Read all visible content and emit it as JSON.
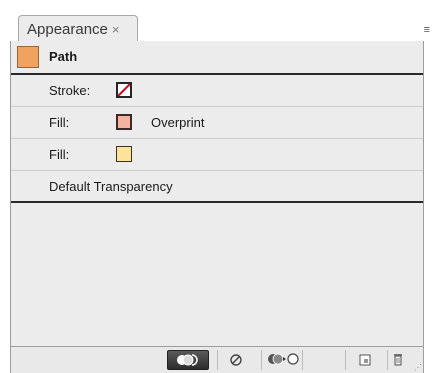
{
  "panel": {
    "tab_label": "Appearance",
    "tab_close": "×",
    "menu_icon": "≡"
  },
  "object": {
    "label": "Path",
    "swatch_color": "#f0a35e"
  },
  "attributes": [
    {
      "label": "Stroke:",
      "swatch": "none",
      "extra": ""
    },
    {
      "label": "Fill:",
      "swatch_color": "#f3b3a0",
      "extra": "Overprint"
    },
    {
      "label": "Fill:",
      "swatch_color": "#fde39a",
      "extra": ""
    }
  ],
  "transparency": {
    "label": "Default Transparency"
  },
  "toolbar_icons": [
    "new-art-basic-appearance-icon",
    "clear-appearance-icon",
    "reduce-to-basic-appearance-icon",
    "duplicate-item-icon",
    "delete-item-icon"
  ]
}
